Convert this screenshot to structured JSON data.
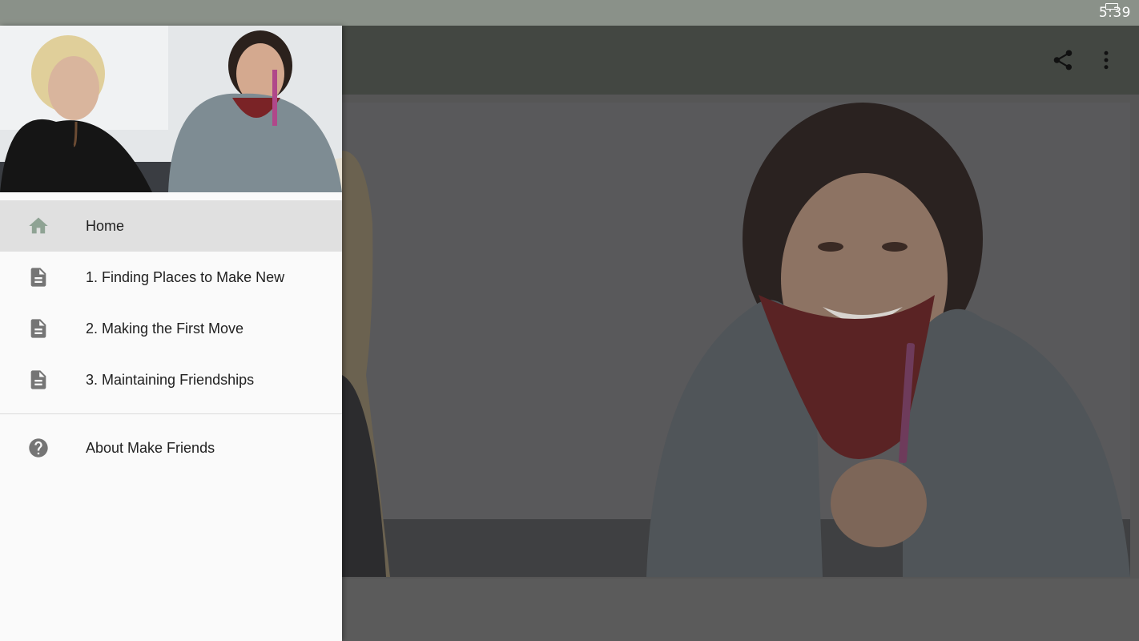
{
  "status_bar": {
    "time": "5:39"
  },
  "toolbar": {
    "share_icon": "share-icon",
    "more_icon": "more-vert-icon"
  },
  "drawer": {
    "items": [
      {
        "label": "Home",
        "icon": "home-icon",
        "selected": true
      },
      {
        "label": "1. Finding Places to Make New",
        "icon": "document-icon"
      },
      {
        "label": "2. Making the First Move",
        "icon": "document-icon"
      },
      {
        "label": "3. Maintaining Friendships",
        "icon": "document-icon"
      }
    ],
    "footer_items": [
      {
        "label": "About Make Friends",
        "icon": "help-icon"
      }
    ]
  },
  "colors": {
    "status_bar": "#8a9189",
    "toolbar": "#434742",
    "drawer_bg": "#fafafa",
    "selected_item_bg": "#e0e0e0",
    "home_icon": "#8fa394",
    "list_icon": "#757575"
  }
}
